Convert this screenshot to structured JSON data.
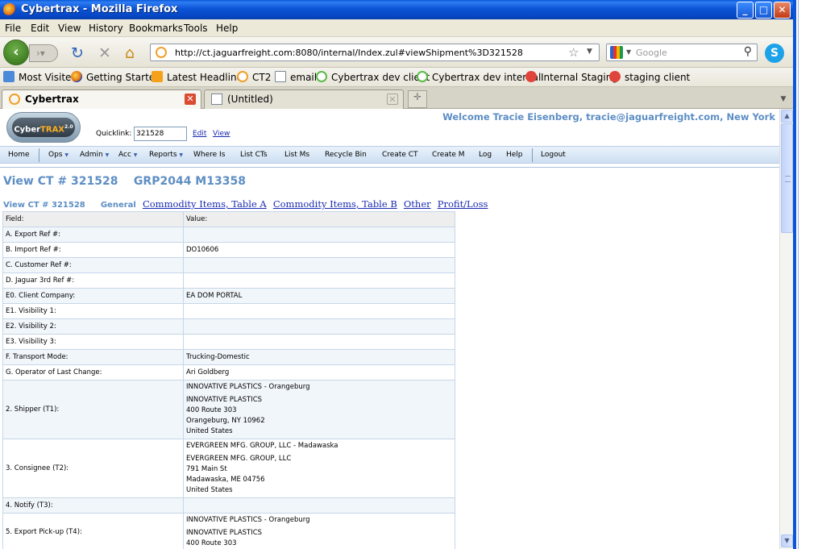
{
  "window": {
    "title": "Cybertrax - Mozilla Firefox",
    "buttons": {
      "minimize": "_",
      "maximize": "□",
      "close": "✕"
    }
  },
  "menu": [
    "File",
    "Edit",
    "View",
    "History",
    "Bookmarks",
    "Tools",
    "Help"
  ],
  "nav": {
    "url": "http://ct.jaguarfreight.com:8080/internal/Index.zul#viewShipment%3D321528",
    "search_placeholder": "Google"
  },
  "bookmarks": [
    "Most Visited",
    "Getting Started",
    "Latest Headlines",
    "CT2",
    "email",
    "Cybertrax dev client",
    "Cybertrax dev internal",
    "Internal Staging",
    "staging client"
  ],
  "tabs": [
    {
      "label": "Cybertrax"
    },
    {
      "label": "(Untitled)"
    }
  ],
  "app": {
    "logo": {
      "text_a": "Cyber",
      "text_b": "TRAX",
      "version": "2.0"
    },
    "quicklink": {
      "label": "Quicklink:",
      "value": "321528",
      "edit": "Edit",
      "view": "View"
    },
    "welcome": "Welcome Tracie Eisenberg, tracie@jaguarfreight.com, New York",
    "menu": [
      "Home",
      "Ops",
      "Admin",
      "Acc",
      "Reports",
      "Where Is",
      "List CTs",
      "List Ms",
      "Recycle Bin",
      "Create CT",
      "Create M",
      "Log",
      "Help",
      "Logout"
    ]
  },
  "page": {
    "title": "View CT # 321528    GRP2044 M13358",
    "subnav_title": "View CT # 321528",
    "subnav_current": "General",
    "subnav_links": [
      "Commodity Items, Table A",
      "Commodity Items, Table B",
      "Other",
      "Profit/Loss"
    ]
  },
  "table": {
    "headers": [
      "Field:",
      "Value:"
    ],
    "rows": [
      {
        "field": "A. Export Ref #:",
        "value": ""
      },
      {
        "field": "B. Import Ref #:",
        "value": "DO10606"
      },
      {
        "field": "C. Customer Ref #:",
        "value": ""
      },
      {
        "field": "D. Jaguar 3rd Ref #:",
        "value": ""
      },
      {
        "field": "E0. Client Company:",
        "value": "EA DOM PORTAL"
      },
      {
        "field": "E1. Visibility 1:",
        "value": ""
      },
      {
        "field": "E2. Visibility 2:",
        "value": ""
      },
      {
        "field": "E3. Visibility 3:",
        "value": ""
      },
      {
        "field": "F. Transport Mode:",
        "value": "Trucking-Domestic"
      },
      {
        "field": "G. Operator of Last Change:",
        "value": "Ari Goldberg"
      }
    ],
    "shipper": {
      "field": "2. Shipper (T1):",
      "first": "INNOVATIVE PLASTICS - Orangeburg",
      "lines": [
        "INNOVATIVE PLASTICS",
        "400 Route 303",
        "Orangeburg, NY 10962",
        "United States"
      ]
    },
    "consignee": {
      "field": "3. Consignee (T2):",
      "first": "EVERGREEN MFG. GROUP, LLC - Madawaska",
      "lines": [
        "EVERGREEN MFG. GROUP, LLC",
        "791 Main St",
        "Madawaska, ME 04756",
        "United States"
      ]
    },
    "notify": {
      "field": "4. Notify (T3):",
      "value": ""
    },
    "pickup": {
      "field": "5. Export Pick-up (T4):",
      "first": "INNOVATIVE PLASTICS - Orangeburg",
      "lines": [
        "INNOVATIVE PLASTICS",
        "400 Route 303"
      ]
    }
  }
}
